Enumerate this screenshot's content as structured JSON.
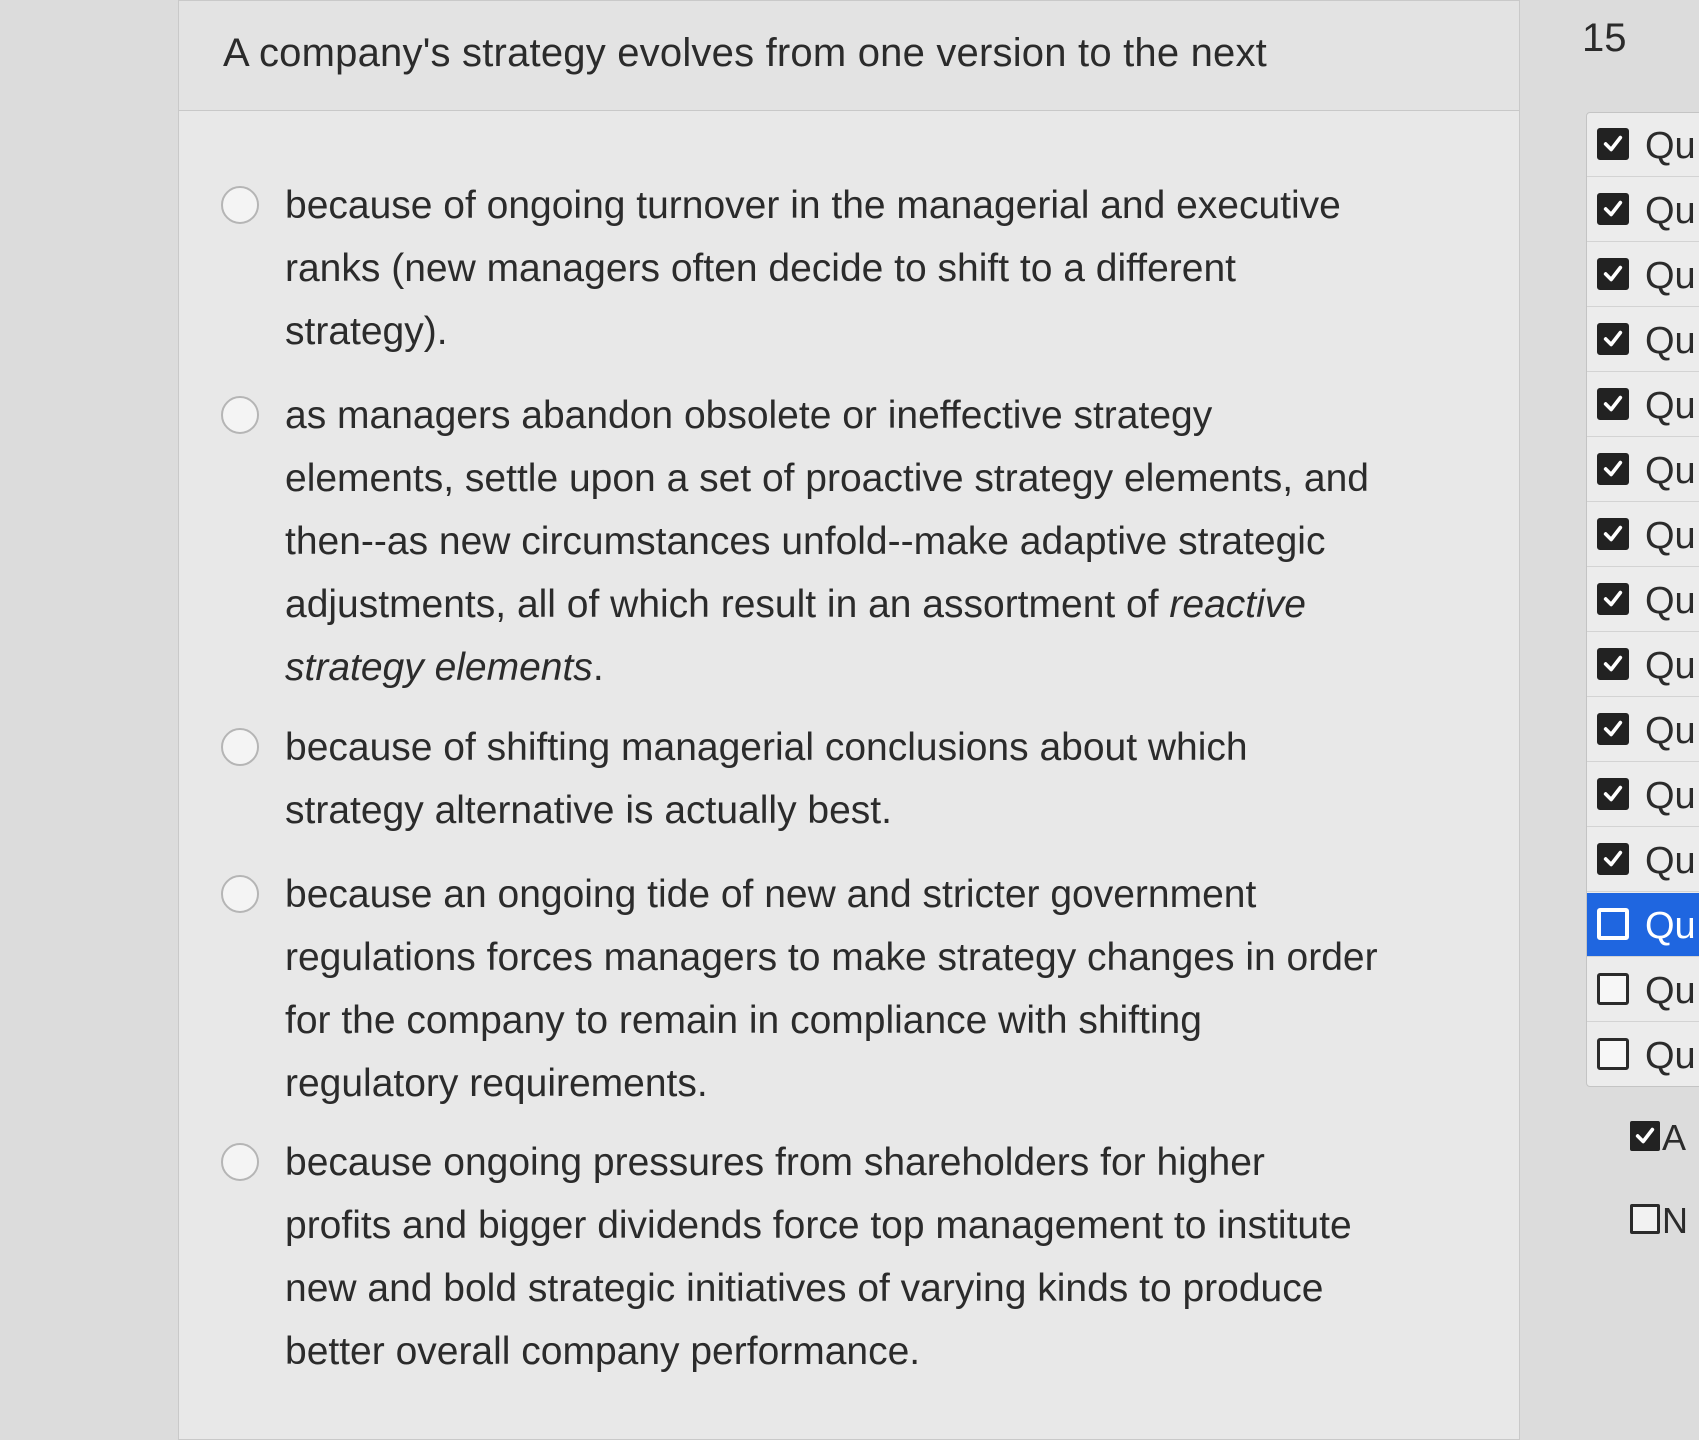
{
  "question": {
    "text": "A company's strategy evolves from one version to the next"
  },
  "options": [
    {
      "lines": [
        "because of ongoing turnover in the managerial and executive",
        "ranks (new managers often decide to shift to a different",
        "strategy)."
      ]
    },
    {
      "lines": [
        "as managers abandon obsolete or ineffective strategy",
        "elements, settle upon a set of proactive strategy elements, and",
        "then--as new circumstances unfold--make adaptive strategic"
      ],
      "line4_prefix": "adjustments, all of which result in an assortment of ",
      "line4_italic": "reactive",
      "line5_italic": "strategy elements",
      "line5_suffix": "."
    },
    {
      "lines": [
        "because of shifting managerial conclusions about which",
        "strategy alternative is actually best."
      ]
    },
    {
      "lines": [
        "because an ongoing tide of new and stricter government",
        "regulations forces managers to make strategy changes in order",
        "for the company to remain in compliance with shifting",
        "regulatory requirements."
      ]
    },
    {
      "lines": [
        "because ongoing pressures from shareholders for higher",
        "profits and bigger dividends force top management to institute",
        "new and bold strategic initiatives of varying kinds to produce",
        "better overall company performance."
      ]
    }
  ],
  "sidebar": {
    "question_number": "15",
    "items": [
      {
        "label": "Qu",
        "state": "checked"
      },
      {
        "label": "Qu",
        "state": "checked"
      },
      {
        "label": "Qu",
        "state": "checked"
      },
      {
        "label": "Qu",
        "state": "checked"
      },
      {
        "label": "Qu",
        "state": "checked"
      },
      {
        "label": "Qu",
        "state": "checked"
      },
      {
        "label": "Qu",
        "state": "checked"
      },
      {
        "label": "Qu",
        "state": "checked"
      },
      {
        "label": "Qu",
        "state": "checked"
      },
      {
        "label": "Qu",
        "state": "checked"
      },
      {
        "label": "Qu",
        "state": "checked"
      },
      {
        "label": "Qu",
        "state": "checked"
      },
      {
        "label": "Qu",
        "state": "current"
      },
      {
        "label": "Qu",
        "state": "unchecked"
      },
      {
        "label": "Qu",
        "state": "unchecked"
      }
    ],
    "legend": {
      "answered": "A",
      "not_answered": "N"
    },
    "active_color": "#1f66e0"
  }
}
